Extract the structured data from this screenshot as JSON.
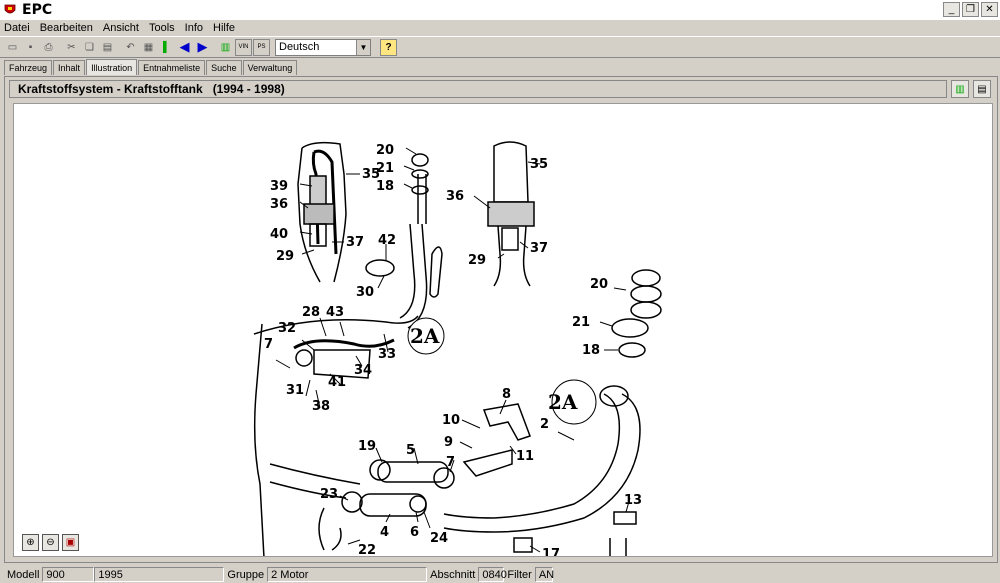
{
  "window": {
    "title": "EPC"
  },
  "menu": [
    "Datei",
    "Bearbeiten",
    "Ansicht",
    "Tools",
    "Info",
    "Hilfe"
  ],
  "toolbar": {
    "language": "Deutsch",
    "vin_label": "VIN",
    "ps_label": "PS",
    "help_glyph": "?"
  },
  "tabs": [
    "Fahrzeug",
    "Inhalt",
    "Illustration",
    "Entnahmeliste",
    "Suche",
    "Verwaltung"
  ],
  "header": {
    "title": "Kraftstoffsystem - Kraftstofftank   (1994 - 1998)"
  },
  "illustration": {
    "labels": [
      "20",
      "21",
      "18",
      "35",
      "39",
      "36",
      "40",
      "29",
      "37",
      "42",
      "30",
      "35",
      "36",
      "37",
      "29",
      "28",
      "43",
      "32",
      "7",
      "33",
      "34",
      "41",
      "31",
      "38",
      "2A",
      "20",
      "21",
      "18",
      "8",
      "2A",
      "10",
      "2",
      "9",
      "11",
      "19",
      "5",
      "7",
      "23",
      "13",
      "4",
      "6",
      "24",
      "22",
      "17"
    ]
  },
  "status": {
    "modell_label": "Modell",
    "modell_value": "900",
    "jahr_value": "1995",
    "gruppe_label": "Gruppe",
    "gruppe_value": "2 Motor",
    "abschnitt_label": "Abschnitt",
    "abschnitt_value": "0840",
    "filter_label": "Filter",
    "filter_value": "AN"
  }
}
